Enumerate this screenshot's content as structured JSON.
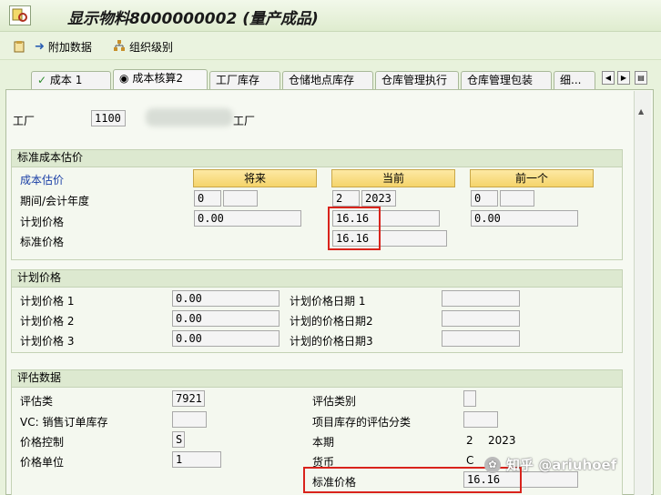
{
  "title": "显示物料8000000002 (量产成品)",
  "toolbar": {
    "additional_data": "附加数据",
    "org_levels": "组织级别"
  },
  "tabs": [
    "成本 1",
    "成本核算2",
    "工厂库存",
    "仓储地点库存",
    "仓库管理执行",
    "仓库管理包装",
    "细..."
  ],
  "plant": {
    "label": "工厂",
    "value": "1100",
    "desc_suffix": "工厂"
  },
  "std_cost": {
    "header": "标准成本估价",
    "row_header": "成本估价",
    "btn_future": "将来",
    "btn_current": "当前",
    "btn_previous": "前一个",
    "period_label": "期间/会计年度",
    "future_period": "0",
    "current_period": "2",
    "current_year": "2023",
    "previous_period": "0",
    "planned_label": "计划价格",
    "future_planned": "0.00",
    "current_planned": "16.16",
    "previous_planned": "0.00",
    "standard_label": "标准价格",
    "current_standard": "16.16"
  },
  "planned": {
    "header": "计划价格",
    "p1_label": "计划价格 1",
    "p1": "0.00",
    "p2_label": "计划价格 2",
    "p2": "0.00",
    "p3_label": "计划价格 3",
    "p3": "0.00",
    "d1_label": "计划价格日期 1",
    "d2_label": "计划的价格日期2",
    "d3_label": "计划的价格日期3"
  },
  "valuation": {
    "header": "评估数据",
    "class_label": "评估类",
    "class_value": "7921",
    "category_label": "评估类别",
    "vc_label": "VC: 销售订单库存",
    "proj_label": "项目库存的评估分类",
    "price_control_label": "价格控制",
    "price_control_value": "S",
    "current_period_label": "本期",
    "current_period_value": "2",
    "current_year_value": "2023",
    "price_unit_label": "价格单位",
    "price_unit_value": "1",
    "currency_label": "货币",
    "currency_value": "C",
    "standard_label": "标准价格",
    "standard_value": "16.16"
  },
  "watermark": "知乎 @ariuhoef"
}
